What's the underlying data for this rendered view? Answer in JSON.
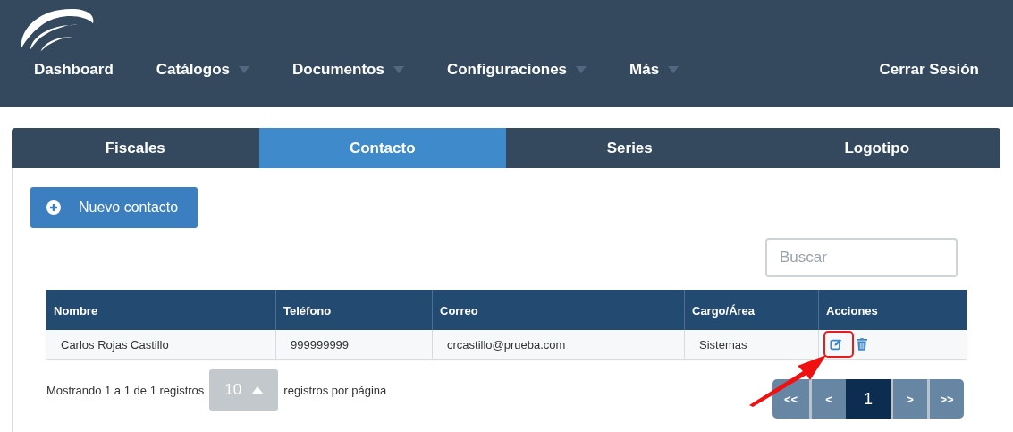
{
  "nav": {
    "items": [
      {
        "label": "Dashboard",
        "dropdown": false
      },
      {
        "label": "Catálogos",
        "dropdown": true
      },
      {
        "label": "Documentos",
        "dropdown": true
      },
      {
        "label": "Configuraciones",
        "dropdown": true
      },
      {
        "label": "Más",
        "dropdown": true
      }
    ],
    "logout": "Cerrar Sesión"
  },
  "tabs": [
    {
      "label": "Fiscales",
      "selected": false
    },
    {
      "label": "Contacto",
      "selected": true
    },
    {
      "label": "Series",
      "selected": false
    },
    {
      "label": "Logotipo",
      "selected": false
    }
  ],
  "new_button": "Nuevo contacto",
  "search": {
    "placeholder": "Buscar"
  },
  "table": {
    "columns": [
      "Nombre",
      "Teléfono",
      "Correo",
      "Cargo/Área",
      "Acciones"
    ],
    "rows": [
      {
        "cells": [
          "Carlos Rojas Castillo",
          "999999999",
          "crcastillo@prueba.com",
          "Sistemas"
        ],
        "highlight_edit": true
      }
    ]
  },
  "footer": {
    "showing": "Mostrando 1 a 1 de 1 registros",
    "page_size": "10",
    "per_page": "registros por página"
  },
  "pagination": [
    {
      "label": "<<",
      "selected": false
    },
    {
      "label": "<",
      "selected": false
    },
    {
      "label": "1",
      "selected": true
    },
    {
      "label": ">",
      "selected": false
    },
    {
      "label": ">>",
      "selected": false
    }
  ]
}
